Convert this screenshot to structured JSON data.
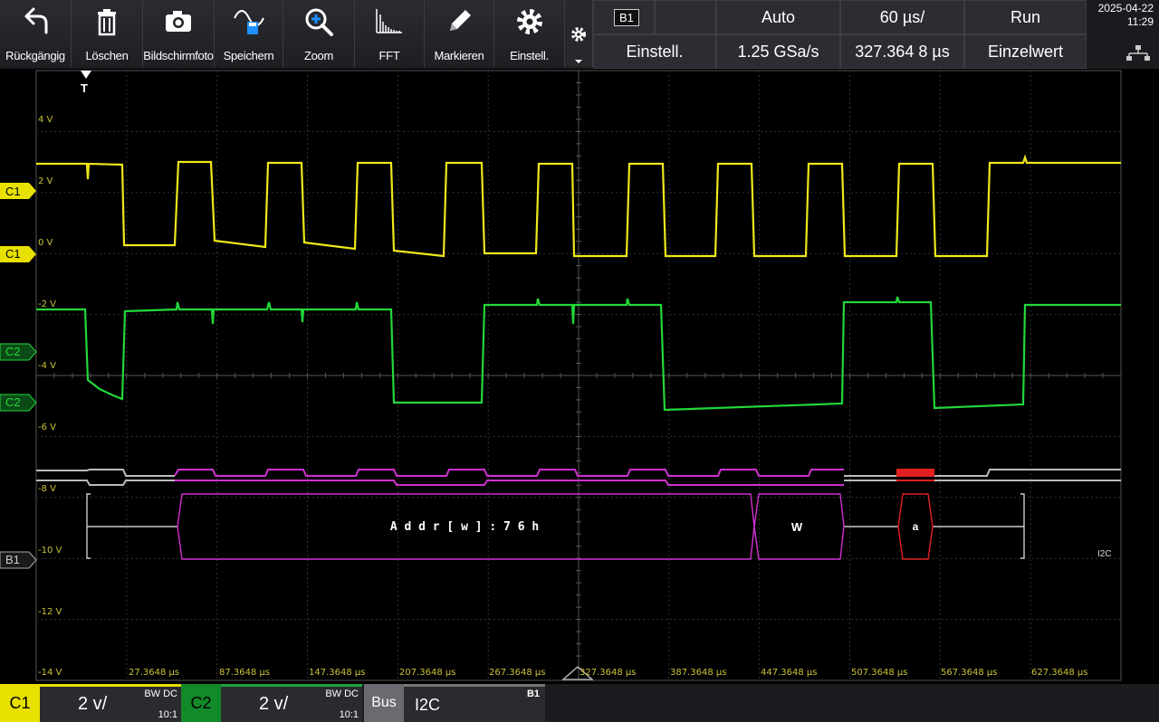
{
  "toolbar": {
    "buttons": [
      {
        "label": "Rückgängig"
      },
      {
        "label": "Löschen"
      },
      {
        "label": "Bildschirmfoto"
      },
      {
        "label": "Speichern"
      },
      {
        "label": "Zoom"
      },
      {
        "label": "FFT"
      },
      {
        "label": "Markieren"
      },
      {
        "label": "Einstell."
      }
    ]
  },
  "status": {
    "trigger_source": "B1",
    "trigger_mode": "Auto",
    "timebase": "60 µs/",
    "run_state": "Run",
    "settings": "Einstell.",
    "sample_rate": "1.25 GSa/s",
    "horizontal_position": "327.364 8 µs",
    "acq_mode": "Einzelwert"
  },
  "datetime": {
    "date": "2025-04-22",
    "time": "11:29"
  },
  "channels": {
    "c1_trigger": "C1",
    "c1": "C1",
    "c2_trigger": "C2",
    "c2": "C2",
    "b1": "B1",
    "trigger_marker": "T"
  },
  "volt_labels": [
    "4 V",
    "2 V",
    "0 V",
    "-2 V",
    "-4 V",
    "-6 V",
    "-8 V",
    "-10 V",
    "-12 V",
    "-14 V"
  ],
  "time_labels": [
    "27.3648 µs",
    "87.3648 µs",
    "147.3648 µs",
    "207.3648 µs",
    "267.3648 µs",
    "327.3648 µs",
    "387.3648 µs",
    "447.3648 µs",
    "507.3648 µs",
    "567.3648 µs",
    "627.3648 µs"
  ],
  "bus": {
    "protocol": "I2C",
    "decode": {
      "address": "A d d r [ w ] : 7 6 h",
      "rw": "W",
      "ack": "a"
    }
  },
  "bottom": {
    "c1": {
      "id": "C1",
      "scale": "2 v/",
      "coupling": "BW DC",
      "probe": "10:1"
    },
    "c2": {
      "id": "C2",
      "scale": "2 v/",
      "coupling": "BW DC",
      "probe": "10:1"
    },
    "bus": {
      "id": "Bus",
      "protocol": "I2C",
      "source": "B1"
    }
  },
  "colors": {
    "c1": "#f0e81a",
    "c2": "#22d83a",
    "bus_addr": "#d030d0",
    "bus_ack": "#e02020",
    "grid": "#3a3a3a"
  }
}
